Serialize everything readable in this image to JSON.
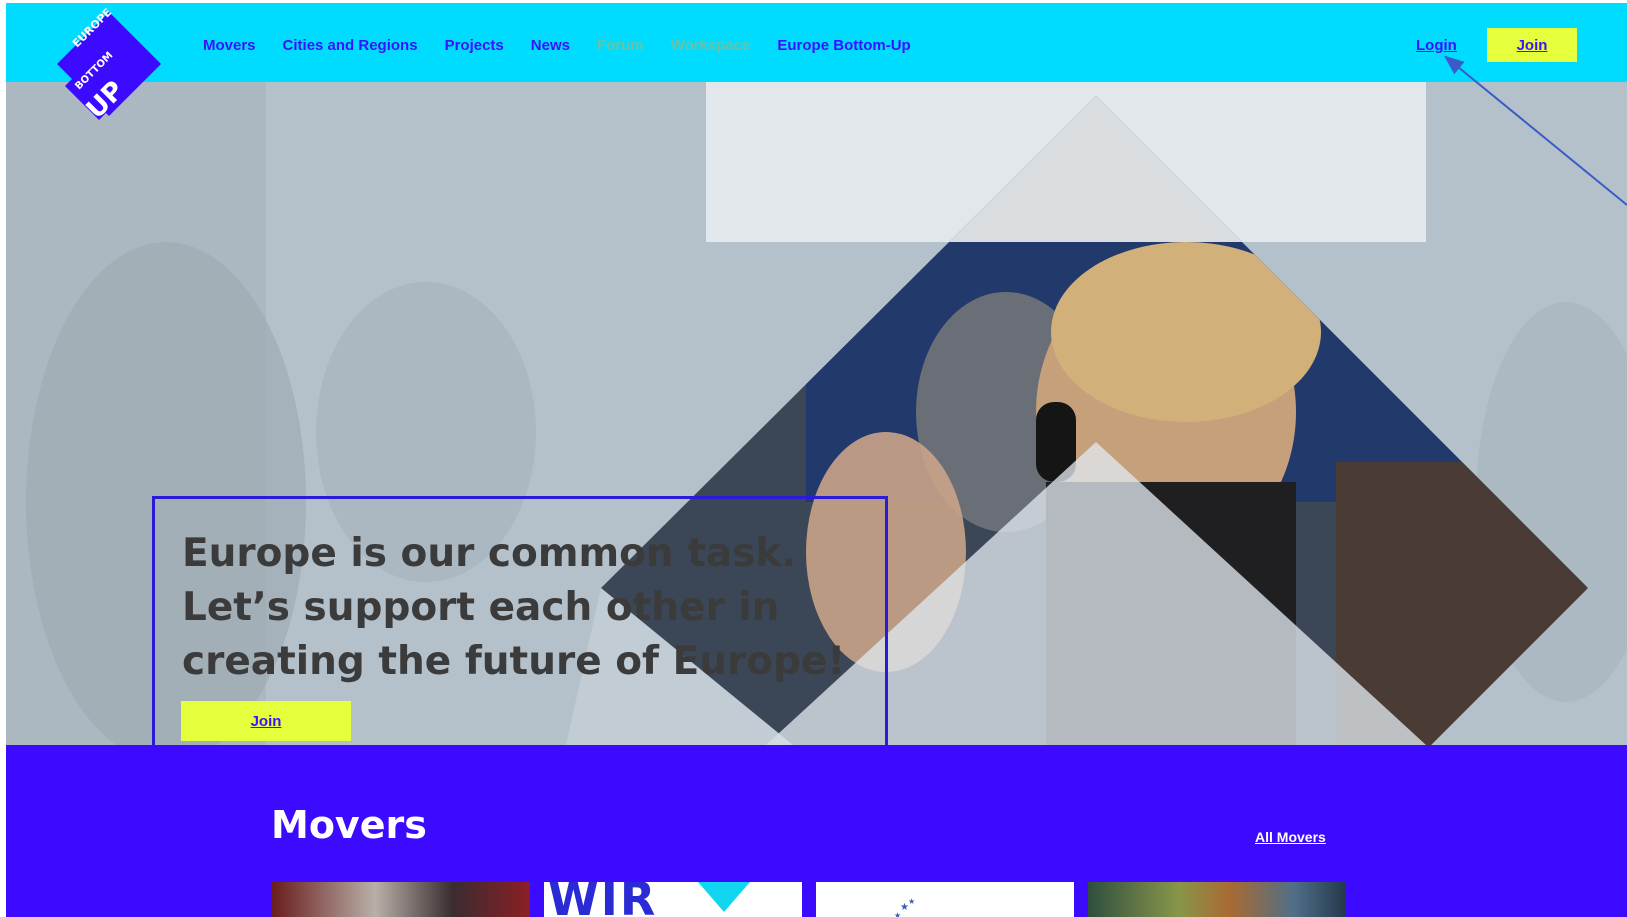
{
  "header": {
    "logo_alt": "Europe Bottom-Up",
    "logo_text": {
      "top": "EUROPE",
      "middle": "BOTTOM",
      "bottom": "UP"
    },
    "nav": [
      {
        "label": "Movers",
        "muted": false
      },
      {
        "label": "Cities and Regions",
        "muted": false
      },
      {
        "label": "Projects",
        "muted": false
      },
      {
        "label": "News",
        "muted": false
      },
      {
        "label": "Forum",
        "muted": true
      },
      {
        "label": "Workspace",
        "muted": true
      },
      {
        "label": "Europe Bottom-Up",
        "muted": false
      }
    ],
    "login_label": "Login",
    "join_label": "Join"
  },
  "hero": {
    "headline_lines": [
      "Europe is our common task.",
      "Let’s support each other in",
      "creating the future of Europe!"
    ],
    "join_label": "Join"
  },
  "movers": {
    "title": "Movers",
    "all_link": "All Movers",
    "cards": [
      {
        "name": "mover-card-1"
      },
      {
        "name": "mover-card-2",
        "text": "WIR"
      },
      {
        "name": "mover-card-3"
      },
      {
        "name": "mover-card-4"
      }
    ]
  },
  "colors": {
    "header_bg": "#00dcff",
    "brand_blue": "#3a12ff",
    "accent_yellow": "#e6ff3c",
    "movers_bg": "#3c0bff",
    "muted_nav": "#6ac2a2",
    "headline_text": "#3b3b3b"
  }
}
